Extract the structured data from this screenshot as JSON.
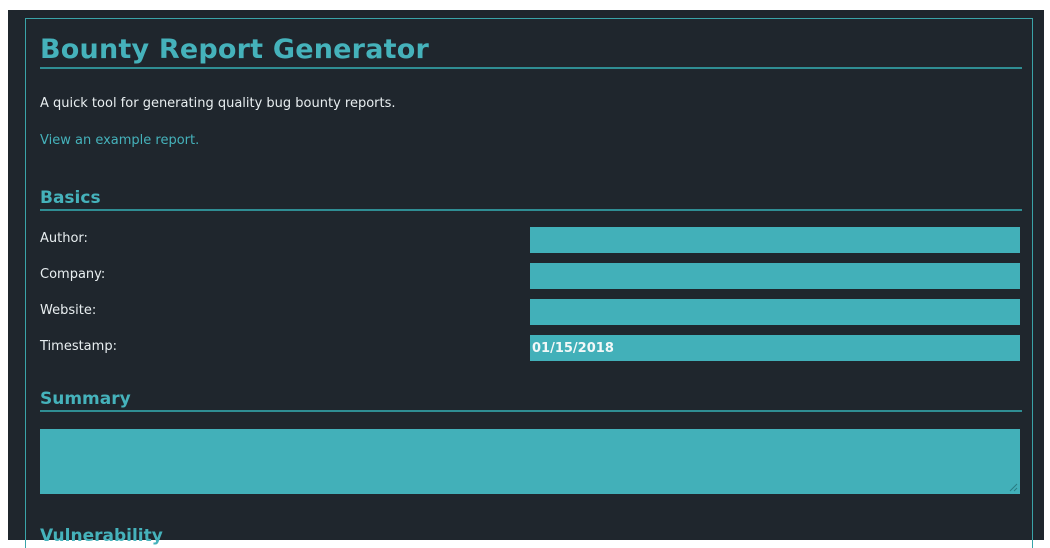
{
  "header": {
    "title": "Bounty Report Generator",
    "subtitle": "A quick tool for generating quality bug bounty reports.",
    "example_link": "View an example report."
  },
  "basics": {
    "heading": "Basics",
    "fields": [
      {
        "label": "Author:",
        "value": ""
      },
      {
        "label": "Company:",
        "value": ""
      },
      {
        "label": "Website:",
        "value": ""
      },
      {
        "label": "Timestamp:",
        "value": "01/15/2018"
      }
    ]
  },
  "summary": {
    "heading": "Summary",
    "value": ""
  },
  "vulnerability": {
    "heading": "Vulnerability"
  },
  "colors": {
    "background": "#1f262d",
    "accent": "#45b2bb",
    "field_fill": "#42b0b9",
    "text": "#e8eef0"
  }
}
